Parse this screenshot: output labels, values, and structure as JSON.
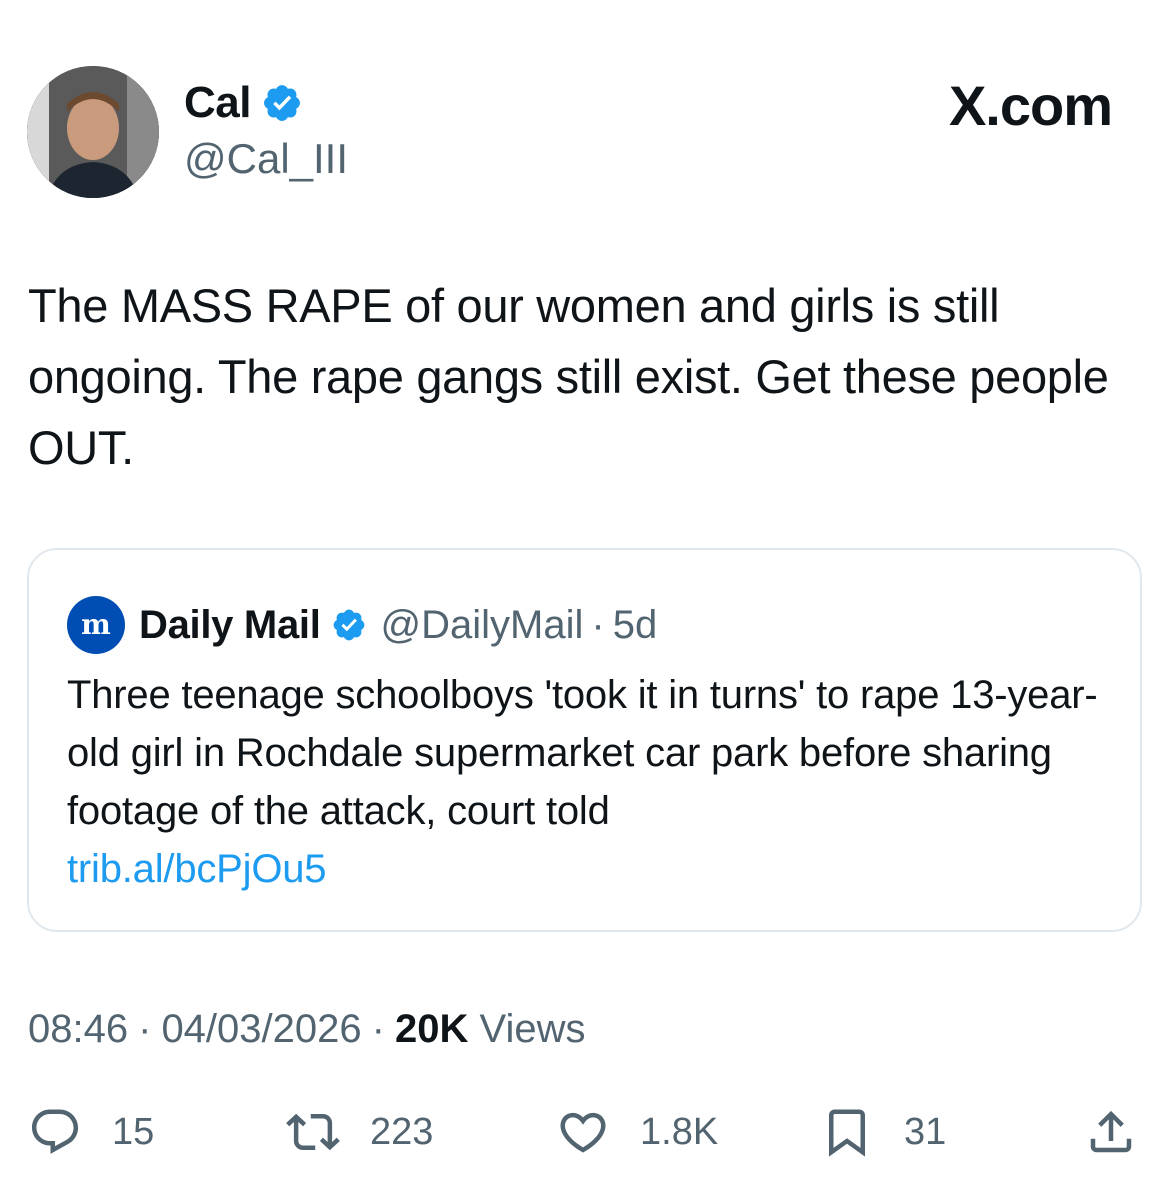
{
  "author": {
    "display_name": "Cal",
    "handle": "@Cal_III",
    "verified": true
  },
  "branding": {
    "site": "X.com"
  },
  "tweet": {
    "text": "The MASS RAPE of our women and girls is still ongoing. The rape gangs still exist. Get these people OUT."
  },
  "quote": {
    "logo_letter": "m",
    "name": "Daily Mail",
    "verified": true,
    "handle": "@DailyMail",
    "separator": "·",
    "time": "5d",
    "text": "Three teenage schoolboys 'took it in turns' to rape 13-year-old girl in Rochdale supermarket car park before sharing footage of the attack, court told",
    "link": "trib.al/bcPjOu5"
  },
  "meta": {
    "time": "08:46",
    "separator": "·",
    "date": "04/03/2026",
    "views_count": "20K",
    "views_label": "Views"
  },
  "actions": {
    "replies": "15",
    "retweets": "223",
    "likes": "1.8K",
    "bookmarks": "31"
  },
  "colors": {
    "verified_blue": "#1d9bf0",
    "link_blue": "#1d9bf0",
    "daily_mail_blue": "#004db3",
    "secondary_text": "#536471"
  },
  "icons": [
    "verified-badge-icon",
    "reply-icon",
    "retweet-icon",
    "like-icon",
    "bookmark-icon",
    "share-icon"
  ]
}
